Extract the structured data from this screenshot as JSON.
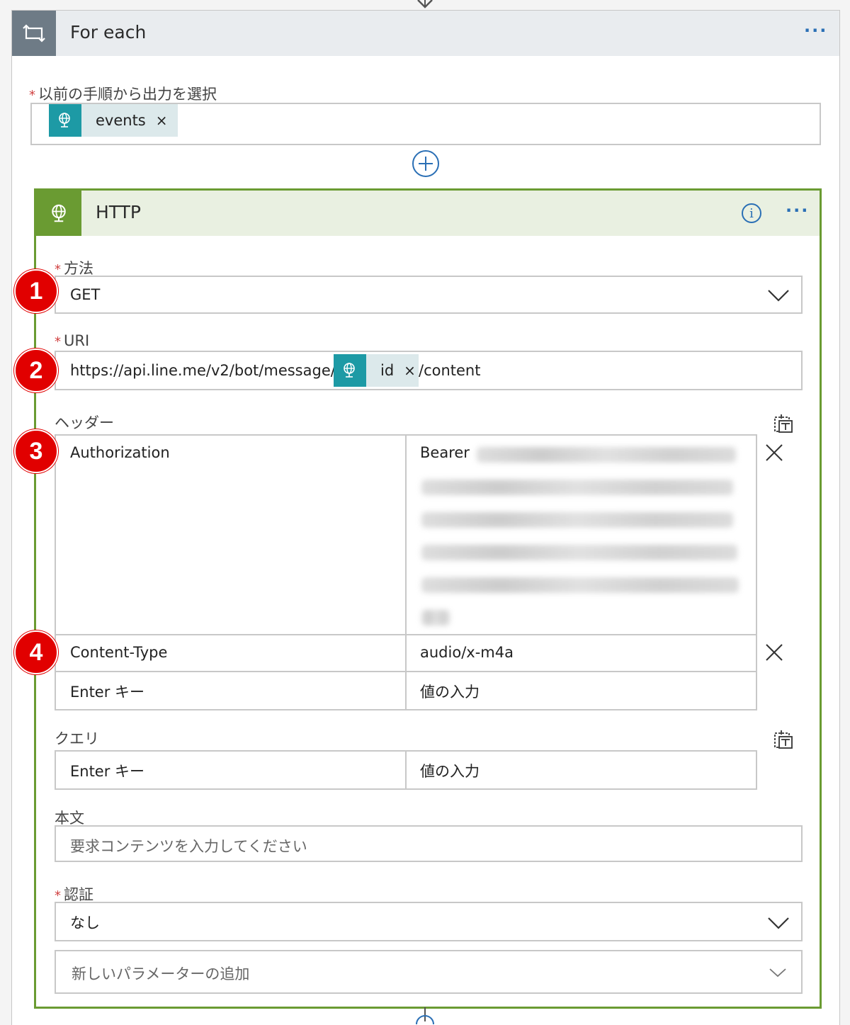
{
  "foreach": {
    "title": "For each",
    "more_label": "···",
    "select_label": "以前の手順から出力を選択",
    "select_token": "events",
    "token_remove": "×"
  },
  "http": {
    "title": "HTTP",
    "info_label": "i",
    "more_label": "···",
    "method": {
      "label": "方法",
      "value": "GET"
    },
    "uri": {
      "label": "URI",
      "prefix": "https://api.line.me/v2/bot/message/",
      "token": "id",
      "token_remove": "×",
      "suffix": "/content"
    },
    "headers": {
      "label": "ヘッダー",
      "rows": [
        {
          "key": "Authorization",
          "value": "Bearer"
        },
        {
          "key": "Content-Type",
          "value": "audio/x-m4a"
        }
      ],
      "key_placeholder": "Enter キー",
      "value_placeholder": "値の入力"
    },
    "queries": {
      "label": "クエリ",
      "key_placeholder": "Enter キー",
      "value_placeholder": "値の入力"
    },
    "body": {
      "label": "本文",
      "placeholder": "要求コンテンツを入力してください"
    },
    "auth": {
      "label": "認証",
      "value": "なし"
    },
    "add_param": {
      "placeholder": "新しいパラメーターの追加"
    }
  },
  "badges": [
    "1",
    "2",
    "3",
    "4"
  ],
  "colors": {
    "foreach_icon_bg": "#6e7b86",
    "http_accent": "#6a9b32",
    "token_bg": "#1d9aa5",
    "link_blue": "#2a6fb5",
    "badge_red": "#e10000",
    "required_star": "#d04040"
  },
  "icons": {
    "foreach": "loop-icon",
    "token": "globe-icon",
    "add": "plus-circle-icon",
    "info": "info-icon",
    "dropdown": "chevron-down-icon",
    "remove": "close-icon",
    "text_mode": "switch-to-text-mode-icon"
  }
}
